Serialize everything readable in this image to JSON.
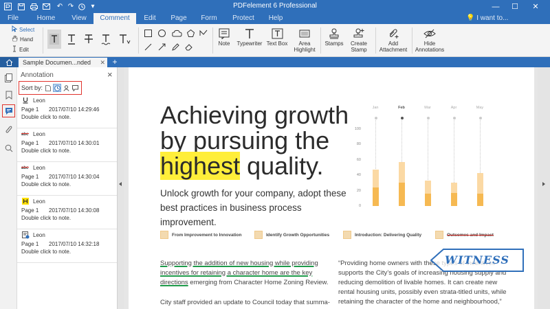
{
  "app": {
    "title": "PDFelement 6 Professional"
  },
  "menu": {
    "tabs": [
      "File",
      "Home",
      "View",
      "Comment",
      "Edit",
      "Page",
      "Form",
      "Protect",
      "Help"
    ],
    "active": "Comment",
    "search": "I want to..."
  },
  "ribbon": {
    "modes": {
      "select": "Select",
      "hand": "Hand",
      "edit": "Edit"
    },
    "buttons": {
      "note": "Note",
      "typewriter": "Typewriter",
      "textbox": "Text Box",
      "area_highlight_1": "Area",
      "area_highlight_2": "Highlight",
      "stamps": "Stamps",
      "create_stamp_1": "Create",
      "create_stamp_2": "Stamp",
      "add_attachment_1": "Add",
      "add_attachment_2": "Attachment",
      "hide_annotations_1": "Hide",
      "hide_annotations_2": "Annotations"
    }
  },
  "tabs": {
    "document": "Sample Documen...nded"
  },
  "panel": {
    "title": "Annotation",
    "sort_by": "Sort by:",
    "items": [
      {
        "icon": "underline",
        "author": "Leon",
        "page": "Page 1",
        "date": "2017/07/10 14:29:46",
        "note": "Double click to note."
      },
      {
        "icon": "strikeout",
        "author": "Leon",
        "page": "Page 1",
        "date": "2017/07/10 14:30:01",
        "note": "Double click to note."
      },
      {
        "icon": "strikeout",
        "author": "Leon",
        "page": "Page 1",
        "date": "2017/07/10 14:30:04",
        "note": "Double click to note."
      },
      {
        "icon": "highlight",
        "author": "Leon",
        "page": "Page 1",
        "date": "2017/07/10 14:30:08",
        "note": "Double click to note."
      },
      {
        "icon": "stamp",
        "author": "Leon",
        "page": "Page 1",
        "date": "2017/07/10 14:32:18",
        "note": "Double click to note."
      }
    ]
  },
  "doc": {
    "headline": {
      "line1": "Achieving growth",
      "line2": "by pursuing the",
      "line3_highlight": "highest",
      "line3_rest": " quality."
    },
    "subhead": "Unlock growth for your company, adopt these best practices in business process improvement.",
    "features": [
      "From Improvement to Innovation",
      "Identify Growth Opportunities",
      "Introduction: Delivering Quality",
      "Outcomes and Impact"
    ],
    "col1_underlined": "Supporting the addition of new housing while providing incentives for retaining a character home are the key directions",
    "col1_rest": " emerging from Character Home Zoning Review.",
    "col1_p2": "City staff provided an update to Council today that summa-",
    "col2": "“Providing home owners with these types of incentives supports the City’s goals of increasing housing supply and reducing demolition of livable homes.  It can create new rental housing units, possibly even strata-titled units, while retaining the character of the home and neighbourhood,”",
    "stamp": "WITNESS"
  },
  "chart_data": {
    "type": "bar",
    "categories": [
      "Jan",
      "Feb",
      "Mar",
      "Apr",
      "May"
    ],
    "highlighted_category": "Feb",
    "yticks": [
      100,
      80,
      60,
      40,
      20,
      0
    ],
    "ylim": [
      0,
      100
    ],
    "series": [
      {
        "values": [
          47,
          57,
          33,
          30,
          43
        ]
      },
      {
        "values": [
          24,
          30,
          16,
          17,
          16
        ]
      }
    ],
    "colors": [
      "#fbd9a4",
      "#f6b952"
    ]
  }
}
